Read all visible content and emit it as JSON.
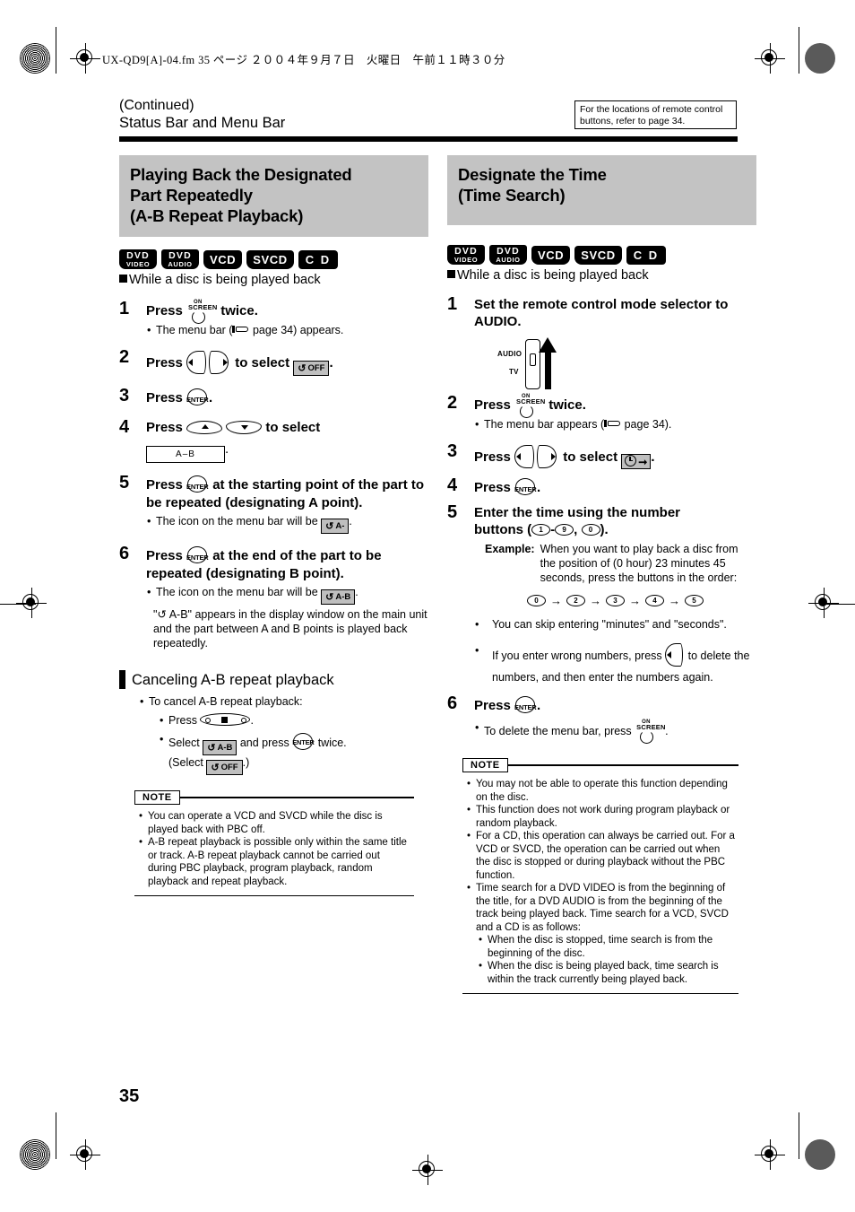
{
  "print_header": {
    "filename_line": "UX-QD9[A]-04.fm  35 ページ  ２００４年９月７日　火曜日　午前１１時３０分"
  },
  "header": {
    "continued": "(Continued)",
    "title": "Status Bar and Menu Bar",
    "ref_box": "For the locations of remote control buttons, refer to page 34."
  },
  "page_number": "35",
  "left_column": {
    "section_title": "Playing Back the Designated Part Repeatedly (A-B Repeat Playback)",
    "section_title_lines": [
      "Playing Back the Designated",
      "Part Repeatedly",
      "(A-B Repeat Playback)"
    ],
    "badges": [
      {
        "name": "dvd-video-badge",
        "line1": "DVD",
        "line2": "VIDEO"
      },
      {
        "name": "dvd-audio-badge",
        "line1": "DVD",
        "line2": "AUDIO"
      },
      {
        "name": "vcd-badge",
        "label": "VCD"
      },
      {
        "name": "svcd-badge",
        "label": "SVCD"
      },
      {
        "name": "cd-badge",
        "label": "C D"
      }
    ],
    "condition": "While a disc is being played back",
    "steps": [
      {
        "num": "1",
        "text_before": "Press",
        "icon": "on-screen-button",
        "text_after": "twice.",
        "sub": "• The menu bar (☞ page 34) appears.",
        "sub_pre": "The menu bar (",
        "sub_post": " page 34) appears."
      },
      {
        "num": "2",
        "text_before": "Press",
        "icon": "left-right-cursor-buttons",
        "text_mid": "to select",
        "chip": "repeat-off-chip",
        "chip_label": "OFF",
        "text_after": "."
      },
      {
        "num": "3",
        "text_before": "Press",
        "icon": "enter-button",
        "text_after": "."
      },
      {
        "num": "4",
        "text_before": "Press",
        "icon": "up-down-cursor-buttons",
        "text_mid": "to select",
        "box_label": "A–B",
        "text_after": "."
      },
      {
        "num": "5",
        "text_before": "Press",
        "icon": "enter-button",
        "text_after": "at the starting point of the part to be repeated (designating A point).",
        "sub_pre": "The icon on the menu bar will be",
        "chip_label": "A-",
        "sub_post": "."
      },
      {
        "num": "6",
        "text_before": "Press",
        "icon": "enter-button",
        "text_after": "at the end of the part to be repeated (designating B point).",
        "sub_pre": "The icon on the menu bar will be",
        "chip_label": "A-B",
        "sub_post": ".",
        "sub2": "\"↺ A-B\" appears in the display window on the main unit and the part between A and B points is played back repeatedly."
      }
    ],
    "subsection": {
      "title": "Canceling A-B repeat playback",
      "intro": "To cancel A-B repeat playback:",
      "item1_pre": "Press",
      "item1_icon": "stop-button",
      "item1_post": ".",
      "item2_pre": "Select",
      "item2_chip": "A-B",
      "item2_mid": "and press",
      "item2_icon": "enter-button",
      "item2_post": "twice.",
      "item2_line2_pre": "(Select",
      "item2_line2_chip": "OFF",
      "item2_line2_post": ".)"
    },
    "note": {
      "label": "NOTE",
      "items": [
        "You can operate a VCD and SVCD while the disc is played back with PBC off.",
        "A-B repeat playback is possible only within the same title or track. A-B repeat playback cannot be carried out during PBC playback, program playback, random playback and repeat playback."
      ]
    }
  },
  "right_column": {
    "section_title": "Designate the Time (Time Search)",
    "section_title_lines": [
      "Designate the Time",
      "(Time Search)"
    ],
    "badges": [
      {
        "name": "dvd-video-badge",
        "line1": "DVD",
        "line2": "VIDEO"
      },
      {
        "name": "dvd-audio-badge",
        "line1": "DVD",
        "line2": "AUDIO"
      },
      {
        "name": "vcd-badge",
        "label": "VCD"
      },
      {
        "name": "svcd-badge",
        "label": "SVCD"
      },
      {
        "name": "cd-badge",
        "label": "C D"
      }
    ],
    "condition": "While a disc is being played back",
    "steps": [
      {
        "num": "1",
        "text": "Set the remote control mode selector to AUDIO.",
        "selector_top_label": "AUDIO",
        "selector_bottom_label": "TV"
      },
      {
        "num": "2",
        "text_before": "Press",
        "icon": "on-screen-button",
        "text_after": "twice.",
        "sub_pre": "The menu bar appears (",
        "sub_post": " page 34)."
      },
      {
        "num": "3",
        "text_before": "Press",
        "icon": "left-right-cursor-buttons",
        "text_mid": "to select",
        "chip": "time-search-chip",
        "text_after": "."
      },
      {
        "num": "4",
        "text_before": "Press",
        "icon": "enter-button",
        "text_after": "."
      },
      {
        "num": "5",
        "text_part1": "Enter the time using the number",
        "text_part2_pre": "buttons (",
        "btn_1": "1",
        "dash": "-",
        "btn_9": "9",
        "comma": ", ",
        "btn_0": "0",
        "text_part2_post": ").",
        "example_label": "Example:",
        "example_text": "When you want to play back a disc from the position of (0 hour) 23 minutes 45 seconds, press the buttons in the order:",
        "sequence": [
          "0",
          "2",
          "3",
          "4",
          "5"
        ],
        "bullet1": "You can skip entering \"minutes\" and \"seconds\".",
        "bullet2_pre": "If you enter wrong numbers, press",
        "bullet2_icon": "left-cursor-button",
        "bullet2_post": "to delete the numbers, and then enter the numbers again."
      },
      {
        "num": "6",
        "text_before": "Press",
        "icon": "enter-button",
        "text_after": ".",
        "sub_pre": "To delete the menu bar, press",
        "sub_icon": "on-screen-button",
        "sub_post": "."
      }
    ],
    "note": {
      "label": "NOTE",
      "items": [
        "You may not be able to operate this function depending on the disc.",
        "This function does not work during program playback or random playback.",
        "For a CD, this operation can always be carried out. For a VCD or SVCD, the operation can be carried out when the disc is stopped or during playback without the PBC function.",
        "Time search for a DVD VIDEO is from the beginning of the title, for a DVD AUDIO is from the beginning of the track being played back. Time search for a VCD, SVCD and a CD is as follows:"
      ],
      "subitems": [
        "When the disc is stopped, time search is from the beginning of the disc.",
        "When the disc is being played back, time search is within the track currently being played back."
      ]
    }
  },
  "colors": {
    "section_bar_bg": "#c3c3c3",
    "badge_bg": "#000000",
    "chip_bg": "#bfbfbf",
    "text": "#000000"
  }
}
